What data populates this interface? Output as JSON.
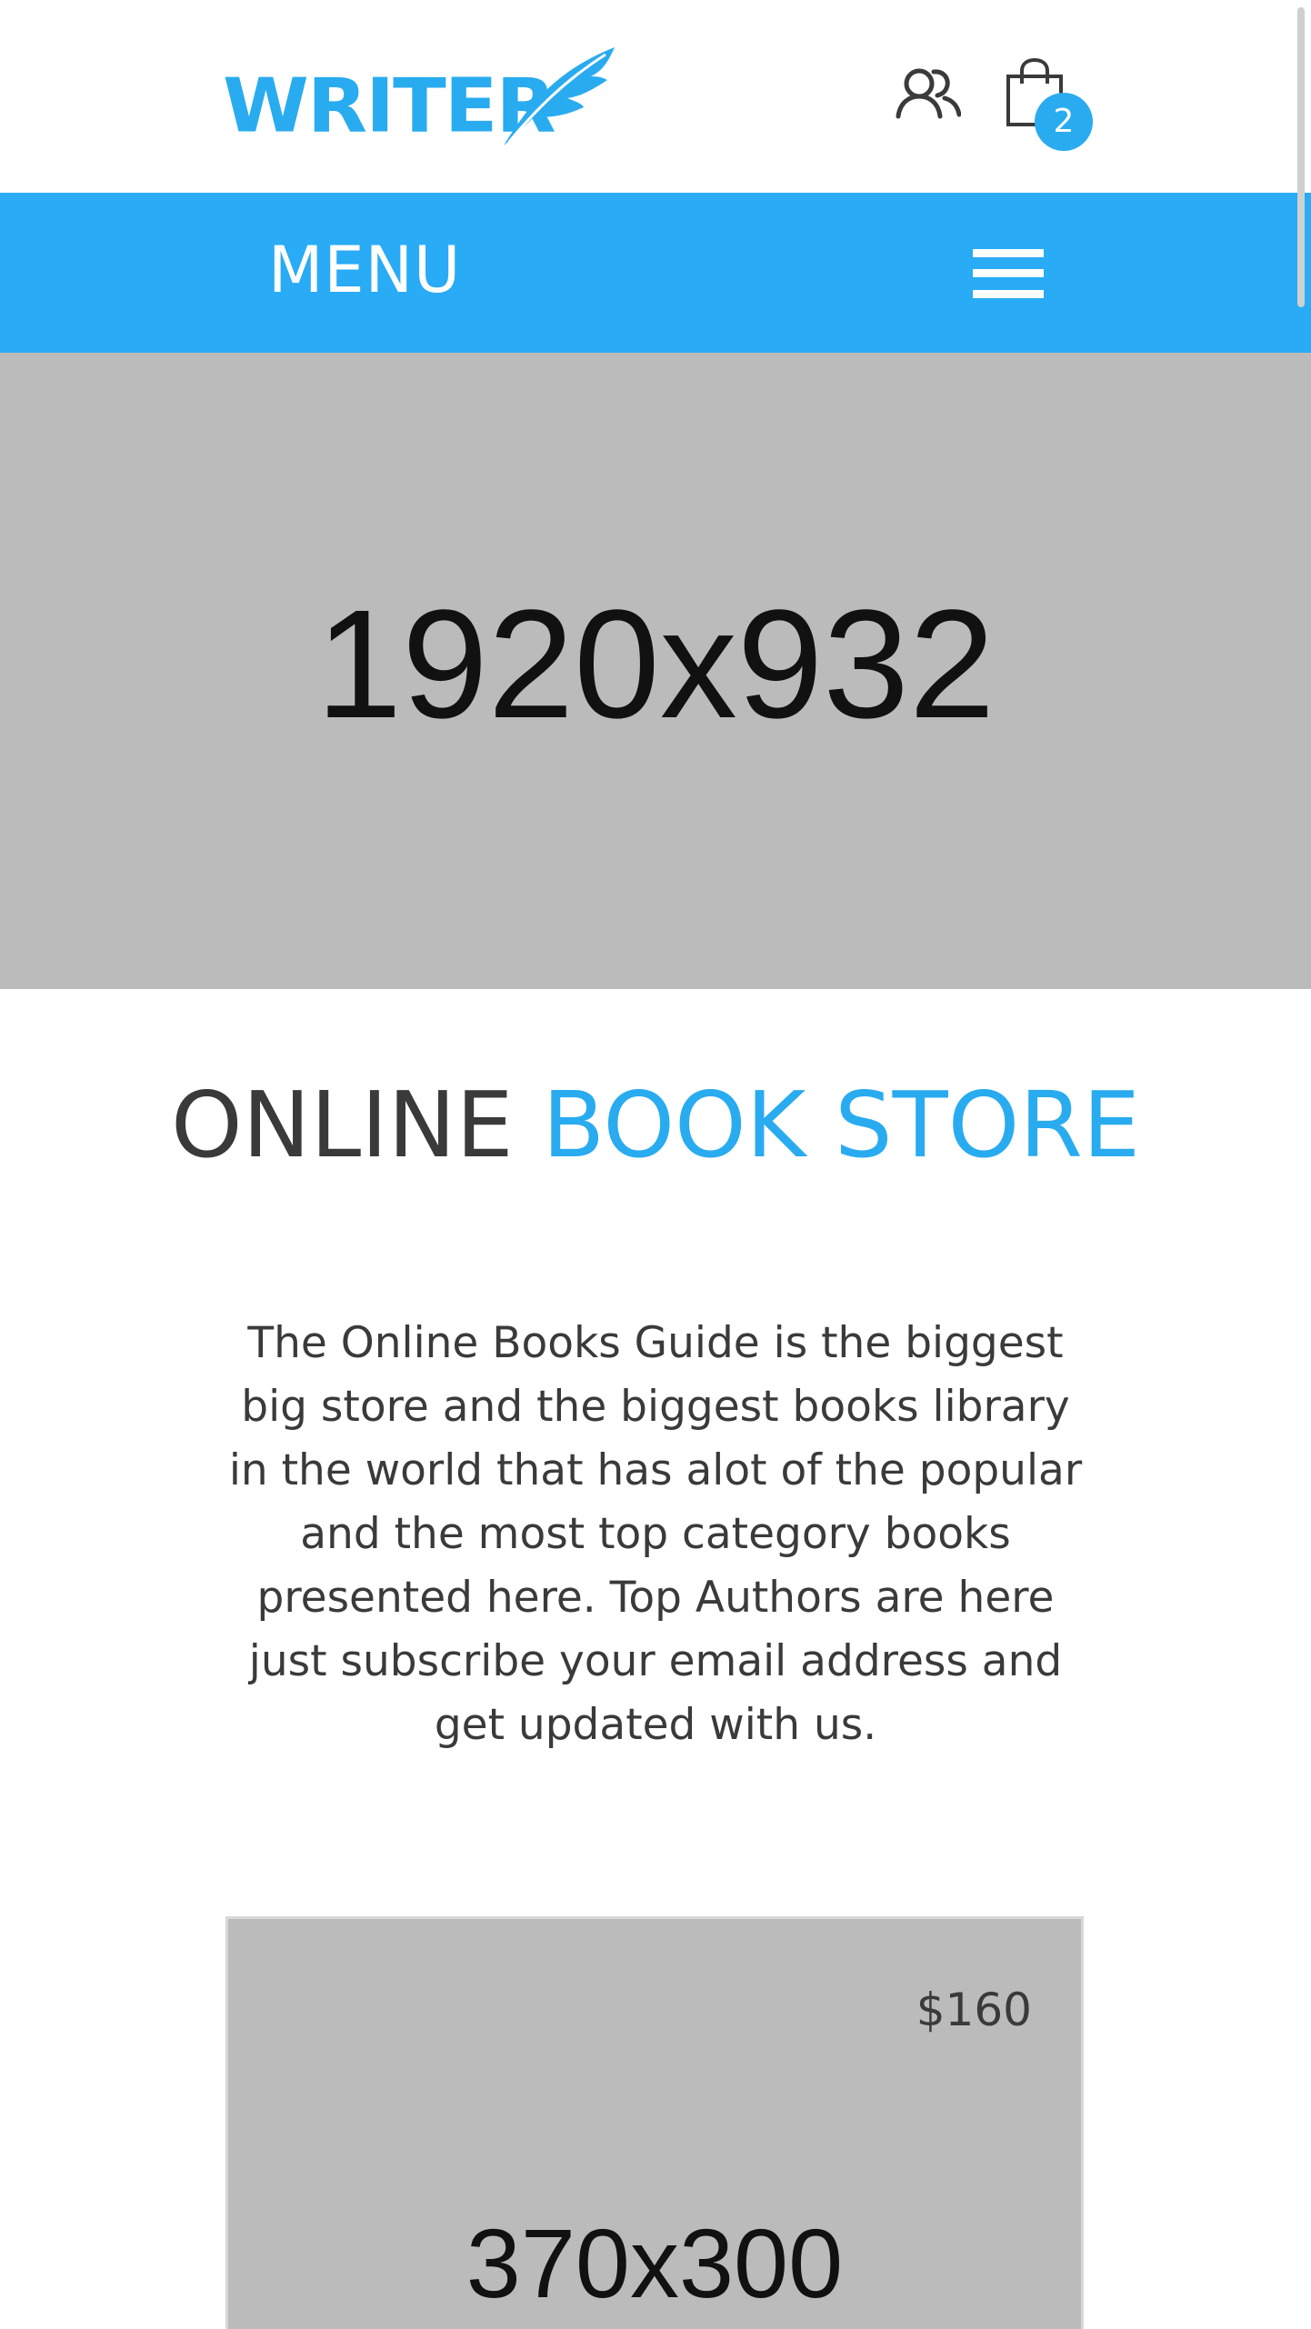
{
  "header": {
    "logo_text": "WRITER",
    "user_icon": "user-group-icon",
    "cart_icon": "shopping-bag-icon",
    "cart_count": "2"
  },
  "menu": {
    "label": "MENU",
    "toggle_icon": "hamburger-icon"
  },
  "hero": {
    "placeholder_label": "1920x932"
  },
  "intro": {
    "title_part1": "ONLINE",
    "title_part2": "BOOK STORE",
    "description": "The Online Books Guide is the biggest big store and the biggest books library in the world that has alot of the popular and the most top category books presented here. Top Authors are here just subscribe your email address and get updated with us."
  },
  "product": {
    "price": "$160",
    "placeholder_label": "370x300"
  },
  "colors": {
    "accent": "#29abf0",
    "menu_bar": "#29abf5",
    "placeholder": "#bbbbbb",
    "text_dark": "#3a3a3a"
  }
}
